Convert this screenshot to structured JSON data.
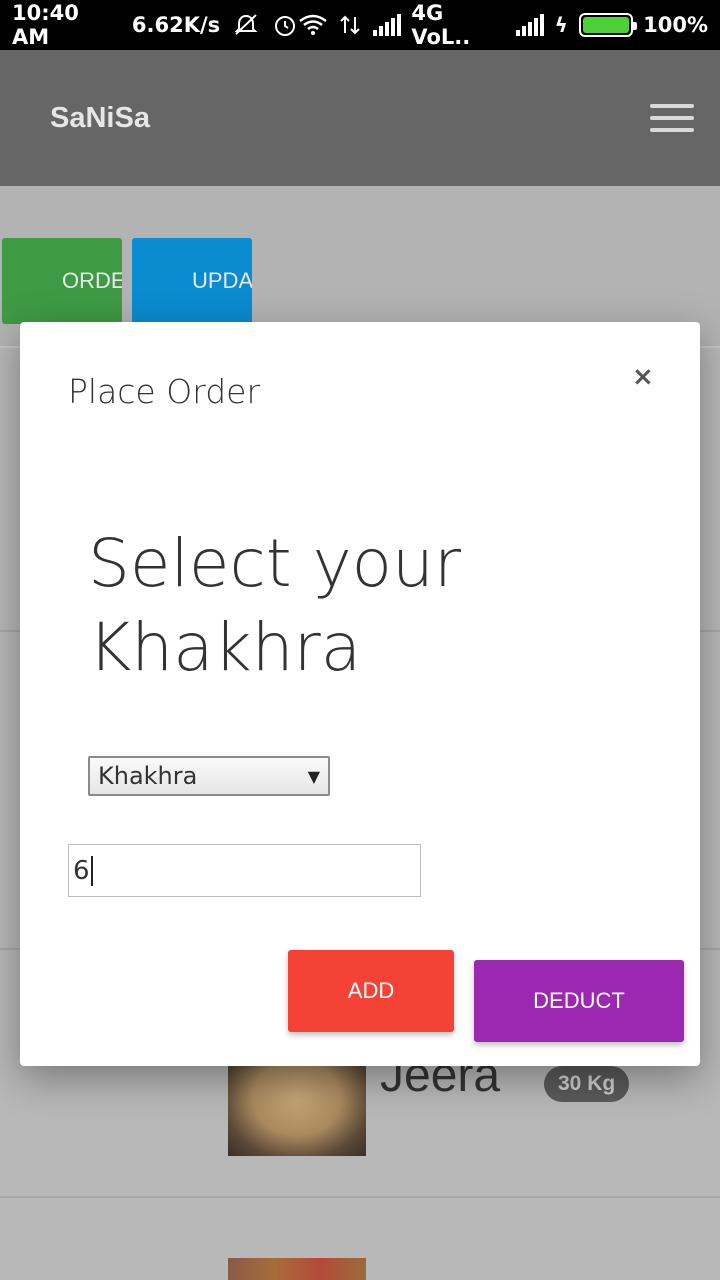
{
  "status_bar": {
    "time": "10:40 AM",
    "speed": "6.62K/s",
    "network": "4G VoL..",
    "battery": "100%",
    "battery_level": 1.0
  },
  "appbar": {
    "title": "SaNiSa",
    "menu_icon": "hamburger-icon"
  },
  "background_buttons": {
    "order_label": "ORDER",
    "update_label": "UPDATE"
  },
  "list": {
    "visible_item": {
      "name": "Jeera",
      "weight": "30 Kg"
    }
  },
  "modal": {
    "title": "Place Order",
    "close_label": "×",
    "heading": "Select your Khakhra",
    "select": {
      "selected": "Khakhra",
      "arrow": "▼"
    },
    "quantity_value": "6",
    "add_label": "ADD",
    "deduct_label": "DEDUCT"
  },
  "colors": {
    "order": "#3f9a45",
    "update": "#0b8bd0",
    "add": "#f44336",
    "deduct": "#9c27b0",
    "appbar": "#666666"
  }
}
